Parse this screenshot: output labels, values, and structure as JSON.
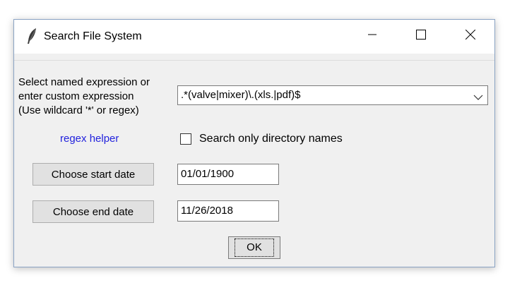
{
  "window": {
    "title": "Search File System"
  },
  "form": {
    "expression_label_lines": [
      "Select named expression or",
      "enter custom expression",
      "(Use wildcard '*' or regex)"
    ],
    "expression_value": ".*(valve|mixer)\\.(xls.|pdf)$",
    "regex_helper_label": "regex helper",
    "dirs_only_label": "Search only directory names",
    "dirs_only_checked": false,
    "start_date_button": "Choose start date",
    "start_date_value": "01/01/1900",
    "end_date_button": "Choose end date",
    "end_date_value": "11/26/2018",
    "ok_label": "OK"
  }
}
